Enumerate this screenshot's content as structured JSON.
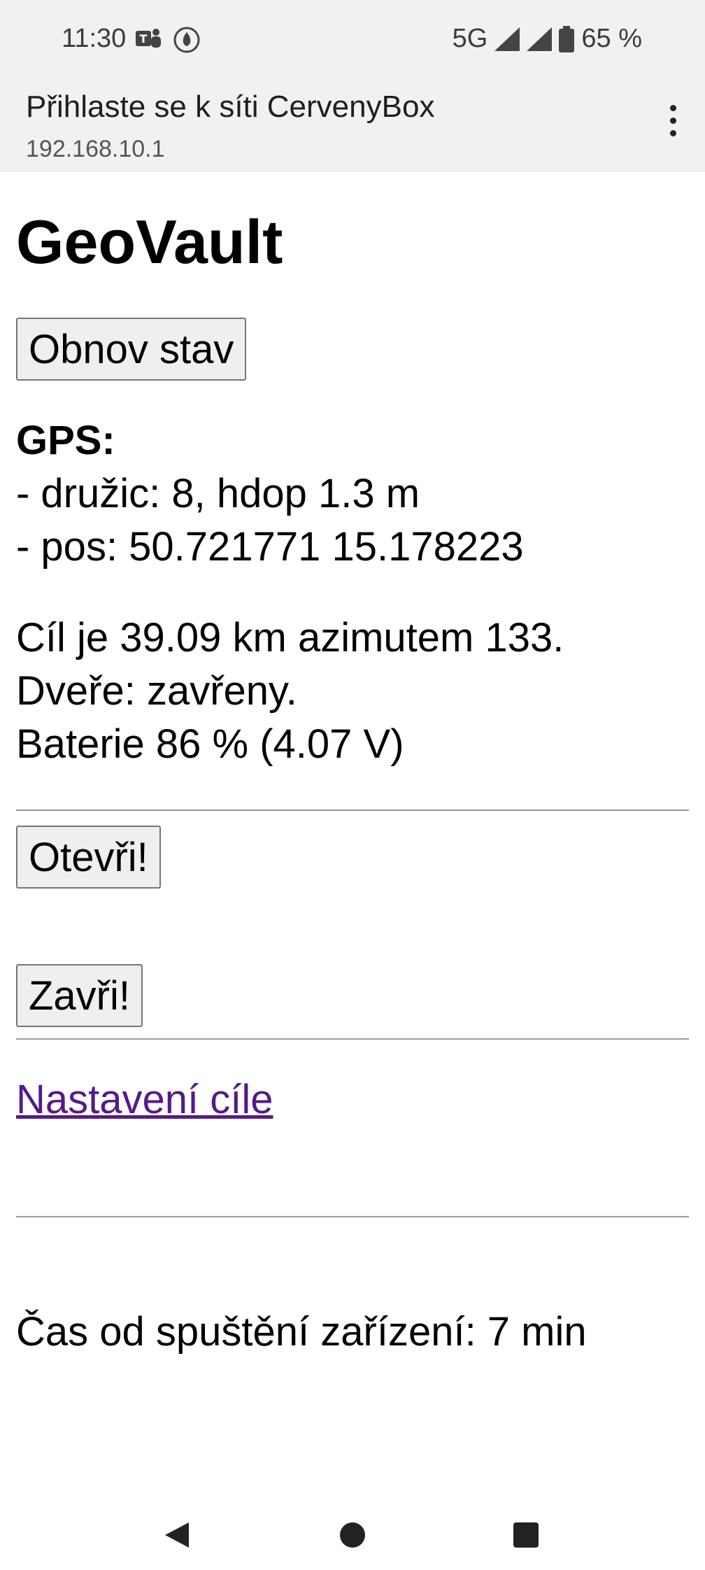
{
  "status_bar": {
    "time": "11:30",
    "network": "5G",
    "battery": "65 %"
  },
  "browser": {
    "title": "Přihlaste se k síti CervenyBox",
    "url": "192.168.10.1"
  },
  "page": {
    "heading": "GeoVault",
    "refresh_button": "Obnov stav",
    "gps_label": "GPS:",
    "gps_sats": "- družic: 8, hdop 1.3 m",
    "gps_pos": "- pos: 50.721771 15.178223",
    "target_line": "Cíl je 39.09 km azimutem 133.",
    "door_line": "Dveře: zavřeny.",
    "battery_line": "Baterie 86 % (4.07 V)",
    "open_button": "Otevři!",
    "close_button": "Zavři!",
    "settings_link": "Nastavení cíle",
    "uptime_line": "Čas od spuštění zařízení: 7 min"
  },
  "icons": [
    "teams-icon",
    "app-icon",
    "signal-icon",
    "battery-icon",
    "more-vert-icon",
    "back-icon",
    "home-icon",
    "recents-icon"
  ]
}
